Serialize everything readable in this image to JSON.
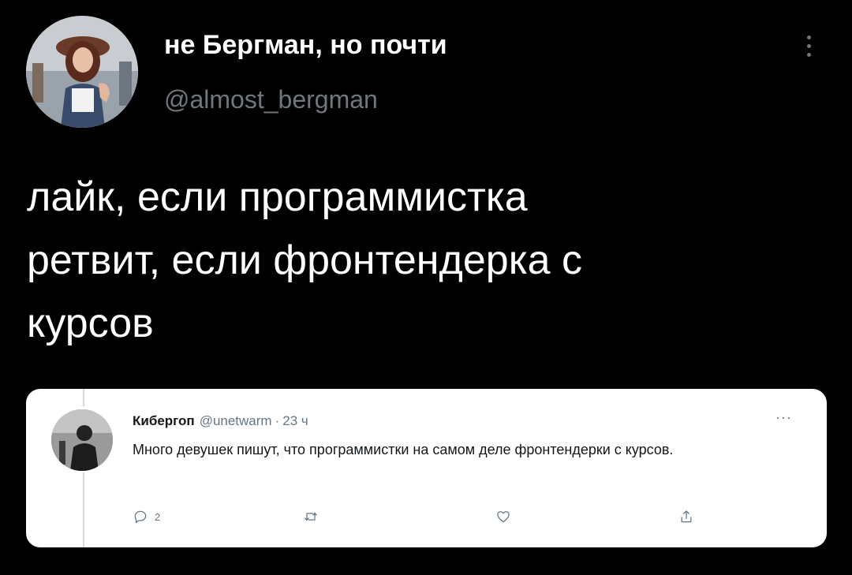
{
  "tweet": {
    "author": {
      "display_name": "не Бергман, но почти",
      "handle": "@almost_bergman"
    },
    "text": "лайк, если программистка\nретвит, если фронтендерка с\nкурсов"
  },
  "quoted_screenshot": {
    "author_name": "Кибергоп",
    "author_handle": "@unetwarm",
    "separator": "·",
    "time": "23 ч",
    "text": "Много девушек пишут, что программистки на самом деле фронтендерки с курсов.",
    "more_label": "···",
    "actions": {
      "reply_count": "2"
    }
  },
  "icons": [
    "more-vertical-icon",
    "reply-icon",
    "retweet-icon",
    "like-icon",
    "share-icon"
  ],
  "colors": {
    "background": "#000000",
    "text_primary": "#ffffff",
    "text_secondary": "#71767b",
    "card_background": "#ffffff",
    "card_muted": "#657786"
  }
}
